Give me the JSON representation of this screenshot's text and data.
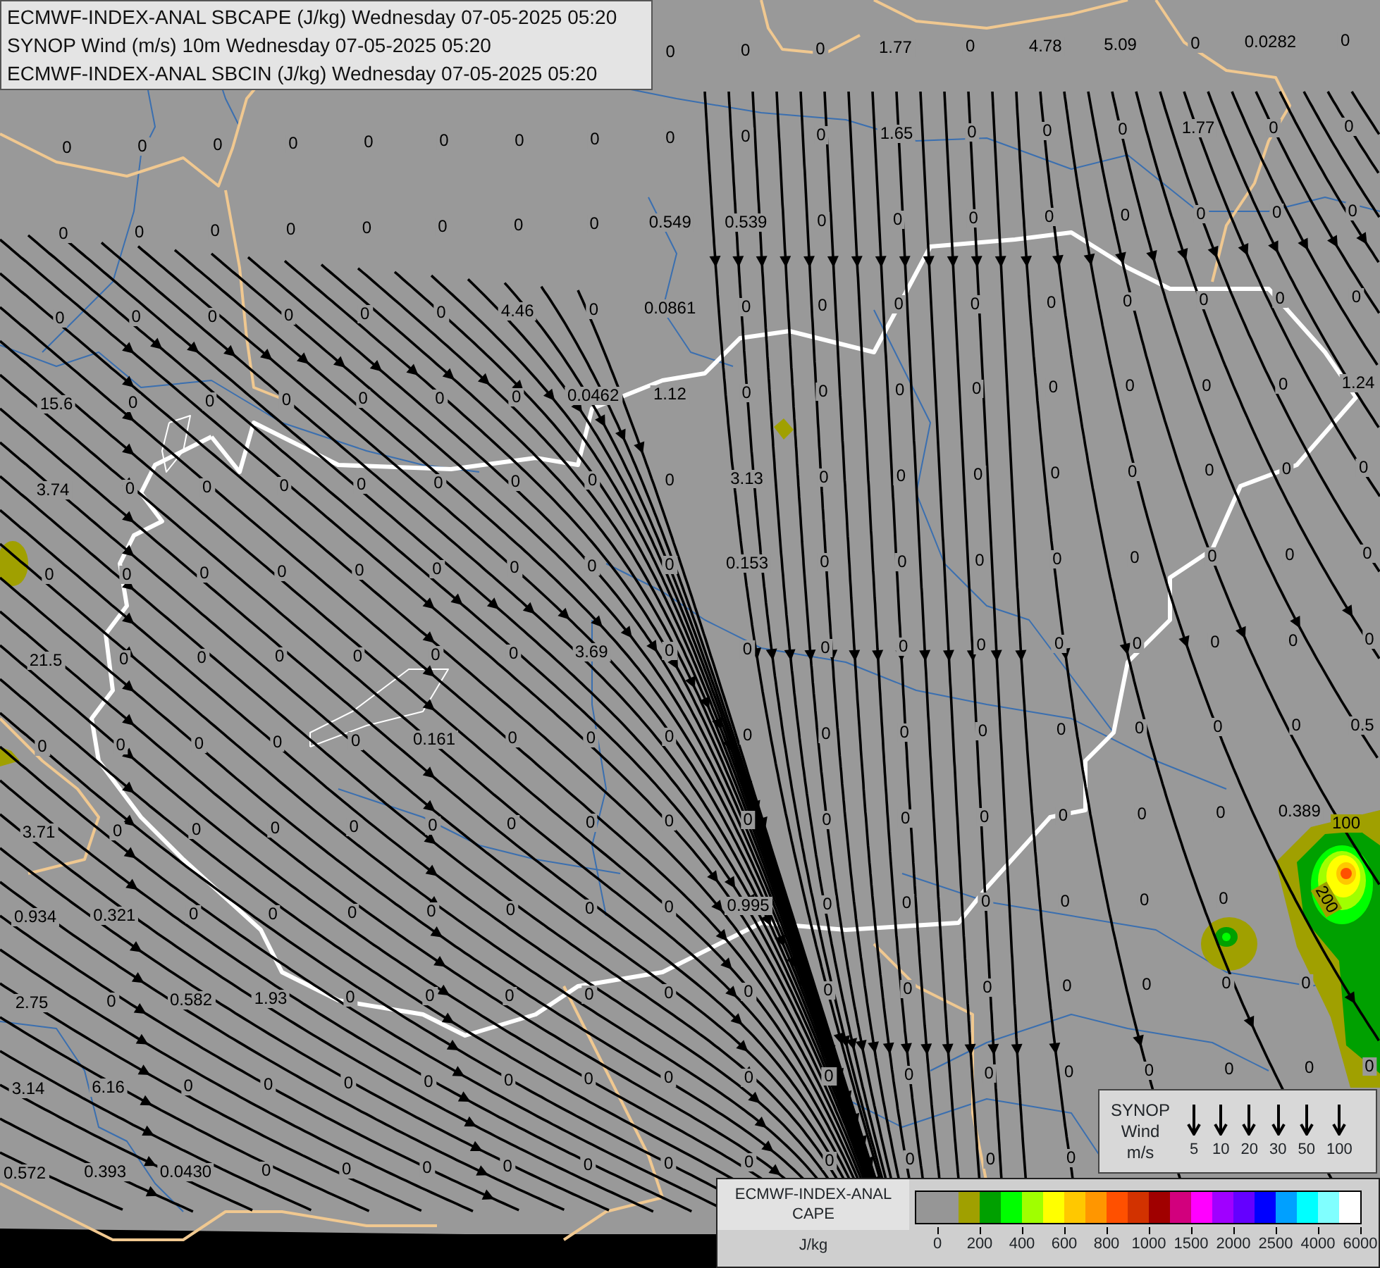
{
  "header": {
    "lines": [
      "ECMWF-INDEX-ANAL SBCAPE (J/kg) Wednesday 07-05-2025 05:20",
      "SYNOP Wind (m/s) 10m Wednesday 07-05-2025 05:20",
      "ECMWF-INDEX-ANAL SBCIN (J/kg) Wednesday 07-05-2025 05:20"
    ]
  },
  "map": {
    "value_grid": [
      [
        "0",
        "0",
        "0",
        "1.77",
        "0",
        "4.78",
        "5.09",
        "0",
        "0.0282",
        "0"
      ],
      [
        "0",
        "0",
        "0",
        "0",
        "0",
        "0",
        "0",
        "0",
        "0",
        "0",
        "0",
        "1.65",
        "0",
        "0",
        "0",
        "1.77",
        "0",
        "0"
      ],
      [
        "0",
        "0",
        "0",
        "0",
        "0",
        "0",
        "0",
        "0",
        "0.549",
        "0.539",
        "0",
        "0",
        "0",
        "0",
        "0",
        "0",
        "0",
        "0"
      ],
      [
        "0",
        "0",
        "0",
        "0",
        "0",
        "0",
        "4.46",
        "0",
        "0.0861",
        "0",
        "0",
        "0",
        "0",
        "0",
        "0",
        "0",
        "0",
        "0"
      ],
      [
        "15.6",
        "0",
        "0",
        "0",
        "0",
        "0",
        "0",
        "0.0462",
        "1.12",
        "0",
        "0",
        "0",
        "0",
        "0",
        "0",
        "0",
        "0",
        "1.24"
      ],
      [
        "3.74",
        "0",
        "0",
        "0",
        "0",
        "0",
        "0",
        "0",
        "0",
        "3.13",
        "0",
        "0",
        "0",
        "0",
        "0",
        "0",
        "0",
        "0"
      ],
      [
        "0",
        "0",
        "0",
        "0",
        "0",
        "0",
        "0",
        "0",
        "0",
        "0.153",
        "0",
        "0",
        "0",
        "0",
        "0",
        "0",
        "0",
        "0"
      ],
      [
        "21.5",
        "0",
        "0",
        "0",
        "0",
        "0",
        "0",
        "3.69",
        "0",
        "0",
        "0",
        "0",
        "0",
        "0",
        "0",
        "0",
        "0",
        "0"
      ],
      [
        "0",
        "0",
        "0",
        "0",
        "0",
        "0.161",
        "0",
        "0",
        "0",
        "0",
        "0",
        "0",
        "0",
        "0",
        "0",
        "0",
        "0",
        "0.5"
      ],
      [
        "3.71",
        "0",
        "0",
        "0",
        "0",
        "0",
        "0",
        "0",
        "0",
        "0",
        "0",
        "0",
        "0",
        "0",
        "0",
        "0",
        "0.389"
      ],
      [
        "0.934",
        "0.321",
        "0",
        "0",
        "0",
        "0",
        "0",
        "0",
        "0",
        "0.995",
        "0",
        "0",
        "0",
        "0",
        "0",
        "0"
      ],
      [
        "2.75",
        "0",
        "0.582",
        "1.93",
        "0",
        "0",
        "0",
        "0",
        "0",
        "0",
        "0",
        "0",
        "0",
        "0",
        "0",
        "0",
        "0"
      ],
      [
        "3.14",
        "6.16",
        "0",
        "0",
        "0",
        "0",
        "0",
        "0",
        "0",
        "0",
        "0",
        "0",
        "0",
        "0",
        "0",
        "0",
        "0",
        "0"
      ],
      [
        "0.572",
        "0.393",
        "0.0430",
        "0",
        "0",
        "0",
        "0",
        "0",
        "0",
        "0",
        "0",
        "0",
        "0",
        "0"
      ]
    ],
    "contour_labels": [
      {
        "text": "100",
        "rotated": false
      },
      {
        "text": "200",
        "rotated": true
      }
    ]
  },
  "wind_legend": {
    "title_lines": [
      "SYNOP",
      "Wind",
      "m/s"
    ],
    "speeds": [
      "5",
      "10",
      "20",
      "30",
      "50",
      "100"
    ]
  },
  "cape_legend": {
    "title_lines": [
      "ECMWF-INDEX-ANAL",
      "CAPE"
    ],
    "unit": "J/kg",
    "swatches": [
      {
        "color": "#969696"
      },
      {
        "color": "#969696"
      },
      {
        "color": "#a0a000"
      },
      {
        "color": "#00a000"
      },
      {
        "color": "#00ff00"
      },
      {
        "color": "#a0ff00"
      },
      {
        "color": "#ffff00"
      },
      {
        "color": "#ffc800"
      },
      {
        "color": "#ff9600"
      },
      {
        "color": "#ff5000"
      },
      {
        "color": "#d23200"
      },
      {
        "color": "#a00000"
      },
      {
        "color": "#d2007d"
      },
      {
        "color": "#ff00ff"
      },
      {
        "color": "#a000ff"
      },
      {
        "color": "#6400ff"
      },
      {
        "color": "#0000ff"
      },
      {
        "color": "#00a0ff"
      },
      {
        "color": "#00ffff"
      },
      {
        "color": "#80ffff"
      },
      {
        "color": "#ffffff"
      }
    ],
    "labels": [
      "0",
      "200",
      "400",
      "600",
      "800",
      "1000",
      "1500",
      "2000",
      "2500",
      "4000",
      "6000"
    ]
  }
}
